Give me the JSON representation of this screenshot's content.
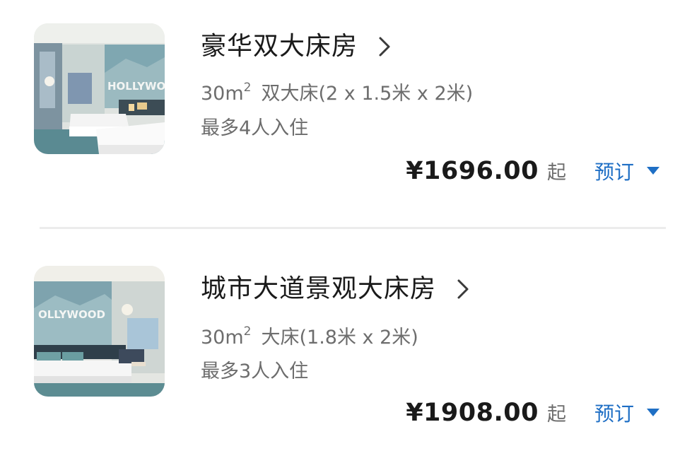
{
  "rooms": [
    {
      "name": "豪华双大床房",
      "area": "30m",
      "area_sup": "2",
      "bed": "双大床(2 x 1.5米 x 2米)",
      "occupancy": "最多4人入住",
      "price": "¥1696.00",
      "price_suffix": "起",
      "book_label": "预订",
      "photo_sign": "HOLLYWO"
    },
    {
      "name": "城市大道景观大床房",
      "area": "30m",
      "area_sup": "2",
      "bed": "大床(1.8米 x 2米)",
      "occupancy": "最多3人入住",
      "price": "¥1908.00",
      "price_suffix": "起",
      "book_label": "预订",
      "photo_sign": "OLLYWOOD"
    }
  ],
  "icons": {
    "detail": "chevron-right-icon",
    "book": "caret-down-icon"
  },
  "colors": {
    "accent": "#1f6fc5",
    "text_primary": "#1a1a1a",
    "text_secondary": "#6d6d6d",
    "divider": "#ececec"
  }
}
